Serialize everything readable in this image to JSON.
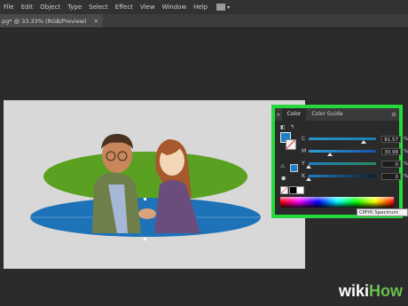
{
  "menubar": {
    "items": [
      "File",
      "Edit",
      "Object",
      "Type",
      "Select",
      "Effect",
      "View",
      "Window",
      "Help"
    ]
  },
  "document_tab": {
    "title": "pg* @ 33.33% (RGB/Preview)",
    "close_glyph": "✕"
  },
  "color_panel": {
    "tabs": [
      "Color",
      "Color Guide"
    ],
    "channels": [
      {
        "label": "C",
        "value": "81.57",
        "unit": "%",
        "level": 0.8157,
        "gradient": "linear-gradient(to right,#2a93c9,#1a80b0)"
      },
      {
        "label": "M",
        "value": "30.98",
        "unit": "%",
        "level": 0.3098,
        "gradient": "linear-gradient(to right,#2aa3d9,#1b4fa5)"
      },
      {
        "label": "Y",
        "value": "0",
        "unit": "%",
        "level": 0.0,
        "gradient": "linear-gradient(to right,#1f7fc8,#2b8e5e)"
      },
      {
        "label": "K",
        "value": "0",
        "unit": "%",
        "level": 0.0,
        "gradient": "linear-gradient(to right,#1f7fc8,#0a1e2e)"
      }
    ],
    "fill_color": "#1f7fc8",
    "accent": "#25d93a"
  },
  "tooltip": {
    "text": "CMYK Spectrum"
  },
  "watermark": {
    "part1": "wiki",
    "part2": "How"
  }
}
